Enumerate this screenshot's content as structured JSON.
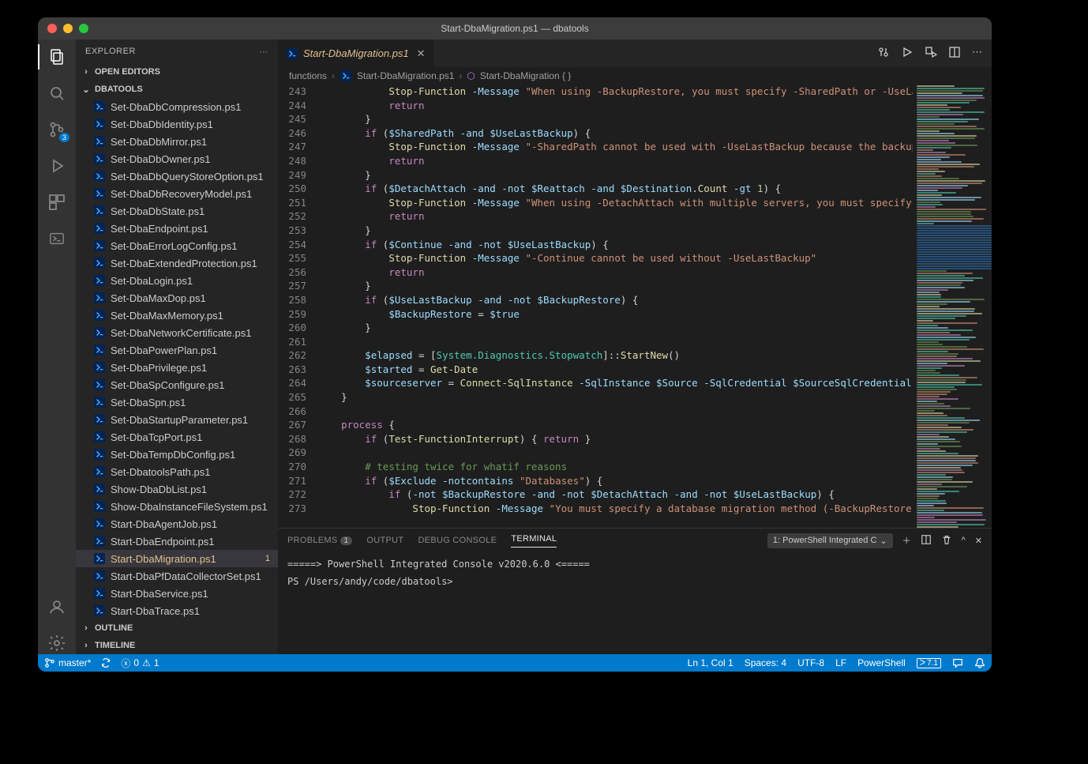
{
  "title": "Start-DbaMigration.ps1 — dbatools",
  "sidebar": {
    "title": "EXPLORER",
    "sections": {
      "open_editors": "OPEN EDITORS",
      "project": "DBATOOLS",
      "outline": "OUTLINE",
      "timeline": "TIMELINE"
    }
  },
  "scm_badge": "3",
  "files": [
    "Set-DbaDbCompression.ps1",
    "Set-DbaDbIdentity.ps1",
    "Set-DbaDbMirror.ps1",
    "Set-DbaDbOwner.ps1",
    "Set-DbaDbQueryStoreOption.ps1",
    "Set-DbaDbRecoveryModel.ps1",
    "Set-DbaDbState.ps1",
    "Set-DbaEndpoint.ps1",
    "Set-DbaErrorLogConfig.ps1",
    "Set-DbaExtendedProtection.ps1",
    "Set-DbaLogin.ps1",
    "Set-DbaMaxDop.ps1",
    "Set-DbaMaxMemory.ps1",
    "Set-DbaNetworkCertificate.ps1",
    "Set-DbaPowerPlan.ps1",
    "Set-DbaPrivilege.ps1",
    "Set-DbaSpConfigure.ps1",
    "Set-DbaSpn.ps1",
    "Set-DbaStartupParameter.ps1",
    "Set-DbaTcpPort.ps1",
    "Set-DbaTempDbConfig.ps1",
    "Set-DbatoolsPath.ps1",
    "Show-DbaDbList.ps1",
    "Show-DbaInstanceFileSystem.ps1",
    "Start-DbaAgentJob.ps1",
    "Start-DbaEndpoint.ps1",
    "Start-DbaMigration.ps1",
    "Start-DbaPfDataCollectorSet.ps1",
    "Start-DbaService.ps1",
    "Start-DbaTrace.ps1"
  ],
  "selected_file_index": 26,
  "modified_badge": "1",
  "tab": {
    "name": "Start-DbaMigration.ps1"
  },
  "breadcrumb": {
    "a": "functions",
    "b": "Start-DbaMigration.ps1",
    "c": "Start-DbaMigration { }"
  },
  "line_start": 243,
  "code_lines": [
    {
      "i": "            ",
      "t": [
        [
          "fn",
          "Stop-Function"
        ],
        [
          "op",
          " "
        ],
        [
          "var",
          "-Message"
        ],
        [
          "op",
          " "
        ],
        [
          "str",
          "\"When using -BackupRestore, you must specify -SharedPath or -UseLas"
        ]
      ]
    },
    {
      "i": "            ",
      "t": [
        [
          "kw",
          "return"
        ]
      ]
    },
    {
      "i": "        ",
      "t": [
        [
          "op",
          "}"
        ]
      ]
    },
    {
      "i": "        ",
      "t": [
        [
          "kw",
          "if"
        ],
        [
          "op",
          " ("
        ],
        [
          "var",
          "$SharedPath"
        ],
        [
          "op",
          " "
        ],
        [
          "var",
          "-and"
        ],
        [
          "op",
          " "
        ],
        [
          "var",
          "$UseLastBackup"
        ],
        [
          "op",
          ") {"
        ]
      ]
    },
    {
      "i": "            ",
      "t": [
        [
          "fn",
          "Stop-Function"
        ],
        [
          "op",
          " "
        ],
        [
          "var",
          "-Message"
        ],
        [
          "op",
          " "
        ],
        [
          "str",
          "\"-SharedPath cannot be used with -UseLastBackup because the backup "
        ]
      ]
    },
    {
      "i": "            ",
      "t": [
        [
          "kw",
          "return"
        ]
      ]
    },
    {
      "i": "        ",
      "t": [
        [
          "op",
          "}"
        ]
      ]
    },
    {
      "i": "        ",
      "t": [
        [
          "kw",
          "if"
        ],
        [
          "op",
          " ("
        ],
        [
          "var",
          "$DetachAttach"
        ],
        [
          "op",
          " "
        ],
        [
          "var",
          "-and"
        ],
        [
          "op",
          " "
        ],
        [
          "var",
          "-not"
        ],
        [
          "op",
          " "
        ],
        [
          "var",
          "$Reattach"
        ],
        [
          "op",
          " "
        ],
        [
          "var",
          "-and"
        ],
        [
          "op",
          " "
        ],
        [
          "var",
          "$Destination"
        ],
        [
          "op",
          "."
        ],
        [
          "fn",
          "Count"
        ],
        [
          "op",
          " "
        ],
        [
          "var",
          "-gt"
        ],
        [
          "op",
          " "
        ],
        [
          "num",
          "1"
        ],
        [
          "op",
          ") {"
        ]
      ]
    },
    {
      "i": "            ",
      "t": [
        [
          "fn",
          "Stop-Function"
        ],
        [
          "op",
          " "
        ],
        [
          "var",
          "-Message"
        ],
        [
          "op",
          " "
        ],
        [
          "str",
          "\"When using -DetachAttach with multiple servers, you must specify -"
        ]
      ]
    },
    {
      "i": "            ",
      "t": [
        [
          "kw",
          "return"
        ]
      ]
    },
    {
      "i": "        ",
      "t": [
        [
          "op",
          "}"
        ]
      ]
    },
    {
      "i": "        ",
      "t": [
        [
          "kw",
          "if"
        ],
        [
          "op",
          " ("
        ],
        [
          "var",
          "$Continue"
        ],
        [
          "op",
          " "
        ],
        [
          "var",
          "-and"
        ],
        [
          "op",
          " "
        ],
        [
          "var",
          "-not"
        ],
        [
          "op",
          " "
        ],
        [
          "var",
          "$UseLastBackup"
        ],
        [
          "op",
          ") {"
        ]
      ]
    },
    {
      "i": "            ",
      "t": [
        [
          "fn",
          "Stop-Function"
        ],
        [
          "op",
          " "
        ],
        [
          "var",
          "-Message"
        ],
        [
          "op",
          " "
        ],
        [
          "str",
          "\"-Continue cannot be used without -UseLastBackup\""
        ]
      ]
    },
    {
      "i": "            ",
      "t": [
        [
          "kw",
          "return"
        ]
      ]
    },
    {
      "i": "        ",
      "t": [
        [
          "op",
          "}"
        ]
      ]
    },
    {
      "i": "        ",
      "t": [
        [
          "kw",
          "if"
        ],
        [
          "op",
          " ("
        ],
        [
          "var",
          "$UseLastBackup"
        ],
        [
          "op",
          " "
        ],
        [
          "var",
          "-and"
        ],
        [
          "op",
          " "
        ],
        [
          "var",
          "-not"
        ],
        [
          "op",
          " "
        ],
        [
          "var",
          "$BackupRestore"
        ],
        [
          "op",
          ") {"
        ]
      ]
    },
    {
      "i": "            ",
      "t": [
        [
          "var",
          "$BackupRestore"
        ],
        [
          "op",
          " = "
        ],
        [
          "var",
          "$true"
        ]
      ]
    },
    {
      "i": "        ",
      "t": [
        [
          "op",
          "}"
        ]
      ]
    },
    {
      "i": "",
      "t": []
    },
    {
      "i": "        ",
      "t": [
        [
          "var",
          "$elapsed"
        ],
        [
          "op",
          " = ["
        ],
        [
          "type",
          "System.Diagnostics.Stopwatch"
        ],
        [
          "op",
          "]::"
        ],
        [
          "fn",
          "StartNew"
        ],
        [
          "op",
          "()"
        ]
      ]
    },
    {
      "i": "        ",
      "t": [
        [
          "var",
          "$started"
        ],
        [
          "op",
          " = "
        ],
        [
          "fn",
          "Get-Date"
        ]
      ]
    },
    {
      "i": "        ",
      "t": [
        [
          "var",
          "$sourceserver"
        ],
        [
          "op",
          " = "
        ],
        [
          "fn",
          "Connect-SqlInstance"
        ],
        [
          "op",
          " "
        ],
        [
          "var",
          "-SqlInstance"
        ],
        [
          "op",
          " "
        ],
        [
          "var",
          "$Source"
        ],
        [
          "op",
          " "
        ],
        [
          "var",
          "-SqlCredential"
        ],
        [
          "op",
          " "
        ],
        [
          "var",
          "$SourceSqlCredential"
        ]
      ]
    },
    {
      "i": "    ",
      "t": [
        [
          "op",
          "}"
        ]
      ]
    },
    {
      "i": "",
      "t": []
    },
    {
      "i": "    ",
      "t": [
        [
          "kw",
          "process"
        ],
        [
          "op",
          " {"
        ]
      ]
    },
    {
      "i": "        ",
      "t": [
        [
          "kw",
          "if"
        ],
        [
          "op",
          " ("
        ],
        [
          "fn",
          "Test-FunctionInterrupt"
        ],
        [
          "op",
          ") { "
        ],
        [
          "kw",
          "return"
        ],
        [
          "op",
          " }"
        ]
      ]
    },
    {
      "i": "",
      "t": []
    },
    {
      "i": "        ",
      "t": [
        [
          "cm",
          "# testing twice for whatif reasons"
        ]
      ]
    },
    {
      "i": "        ",
      "t": [
        [
          "kw",
          "if"
        ],
        [
          "op",
          " ("
        ],
        [
          "var",
          "$Exclude"
        ],
        [
          "op",
          " "
        ],
        [
          "var",
          "-notcontains"
        ],
        [
          "op",
          " "
        ],
        [
          "str",
          "\"Databases\""
        ],
        [
          "op",
          ") {"
        ]
      ]
    },
    {
      "i": "            ",
      "t": [
        [
          "kw",
          "if"
        ],
        [
          "op",
          " ("
        ],
        [
          "var",
          "-not"
        ],
        [
          "op",
          " "
        ],
        [
          "var",
          "$BackupRestore"
        ],
        [
          "op",
          " "
        ],
        [
          "var",
          "-and"
        ],
        [
          "op",
          " "
        ],
        [
          "var",
          "-not"
        ],
        [
          "op",
          " "
        ],
        [
          "var",
          "$DetachAttach"
        ],
        [
          "op",
          " "
        ],
        [
          "var",
          "-and"
        ],
        [
          "op",
          " "
        ],
        [
          "var",
          "-not"
        ],
        [
          "op",
          " "
        ],
        [
          "var",
          "$UseLastBackup"
        ],
        [
          "op",
          ") {"
        ]
      ]
    },
    {
      "i": "                ",
      "t": [
        [
          "fn",
          "Stop-Function"
        ],
        [
          "op",
          " "
        ],
        [
          "var",
          "-Message"
        ],
        [
          "op",
          " "
        ],
        [
          "str",
          "\"You must specify a database migration method (-BackupRestore o"
        ]
      ]
    }
  ],
  "panel": {
    "tabs": {
      "problems": "PROBLEMS",
      "problems_badge": "1",
      "output": "OUTPUT",
      "debug": "DEBUG CONSOLE",
      "terminal": "TERMINAL"
    },
    "term_select": "1: PowerShell Integrated C",
    "term_line1": "=====> PowerShell Integrated Console v2020.6.0 <=====",
    "term_line2": "PS /Users/andy/code/dbatools>"
  },
  "status": {
    "branch": "master*",
    "errors": "0",
    "warnings": "1",
    "pos": "Ln 1, Col 1",
    "spaces": "Spaces: 4",
    "enc": "UTF-8",
    "eol": "LF",
    "lang": "PowerShell",
    "psver": "7.1"
  }
}
